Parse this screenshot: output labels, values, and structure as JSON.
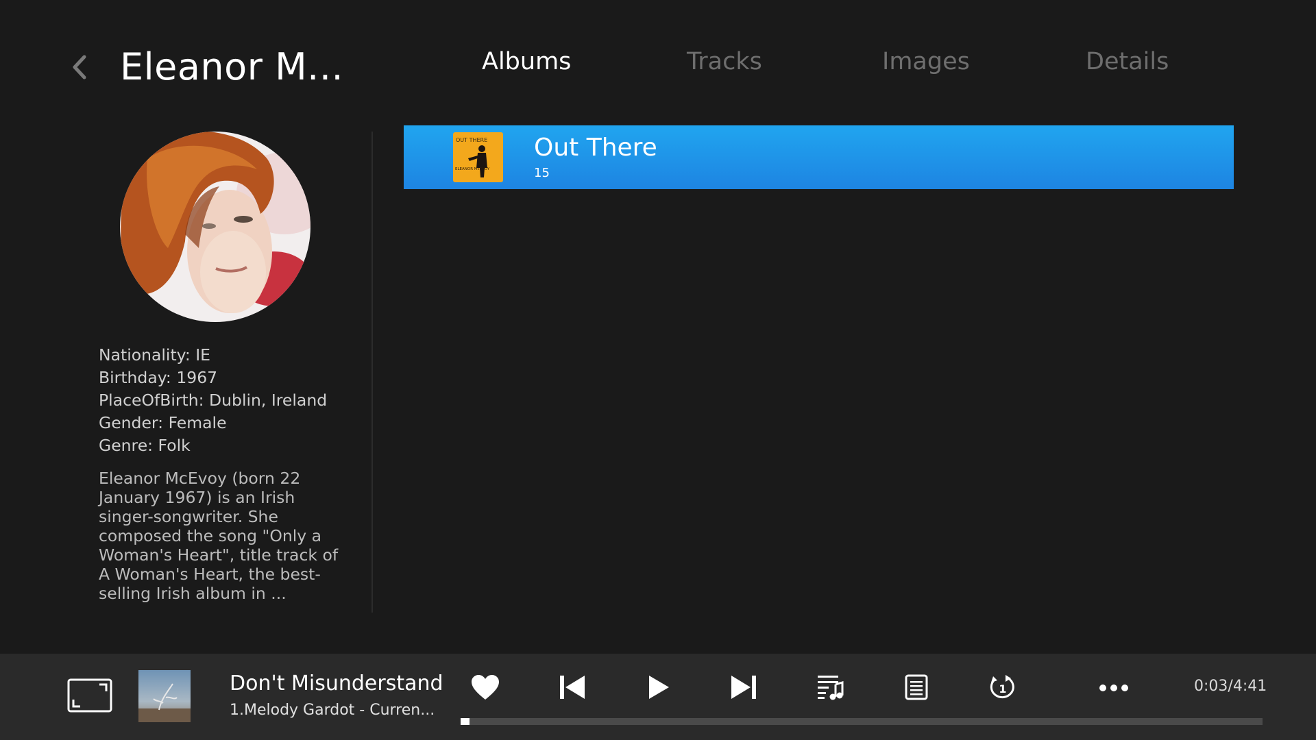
{
  "header": {
    "artist_name": "Eleanor M...",
    "tabs": [
      {
        "label": "Albums",
        "active": true
      },
      {
        "label": "Tracks",
        "active": false
      },
      {
        "label": "Images",
        "active": false
      },
      {
        "label": "Details",
        "active": false
      }
    ]
  },
  "artist": {
    "facts": [
      "Nationality: IE",
      "Birthday: 1967",
      "PlaceOfBirth: Dublin, Ireland",
      "Gender: Female",
      "Genre: Folk"
    ],
    "bio": "Eleanor McEvoy (born 22 January 1967) is an Irish singer-songwriter. She composed the song \"Only a Woman's Heart\", title track of A Woman's Heart, the best-selling Irish album in ..."
  },
  "albums": [
    {
      "name": "Out There",
      "count": "15",
      "cover_text_top": "OUT THERE",
      "cover_text_bottom": "ELEANOR McEVOY"
    }
  ],
  "player": {
    "track_title": "Don't Misunderstand",
    "track_subtitle": "1.Melody Gardot - Curren...",
    "time": "0:03/4:41",
    "progress": 0.011
  },
  "colors": {
    "accent": "#1e9be8",
    "background": "#1a1a1a",
    "player_bar": "#2a2a2a"
  },
  "icons": {
    "back": "chevron-left-icon",
    "fullscreen": "fullscreen-icon",
    "favorite": "heart-icon",
    "previous": "skip-previous-icon",
    "play": "play-icon",
    "next": "skip-next-icon",
    "playlist": "playlist-music-icon",
    "lyrics": "document-lines-icon",
    "repeat": "repeat-one-icon",
    "more": "more-horizontal-icon"
  }
}
